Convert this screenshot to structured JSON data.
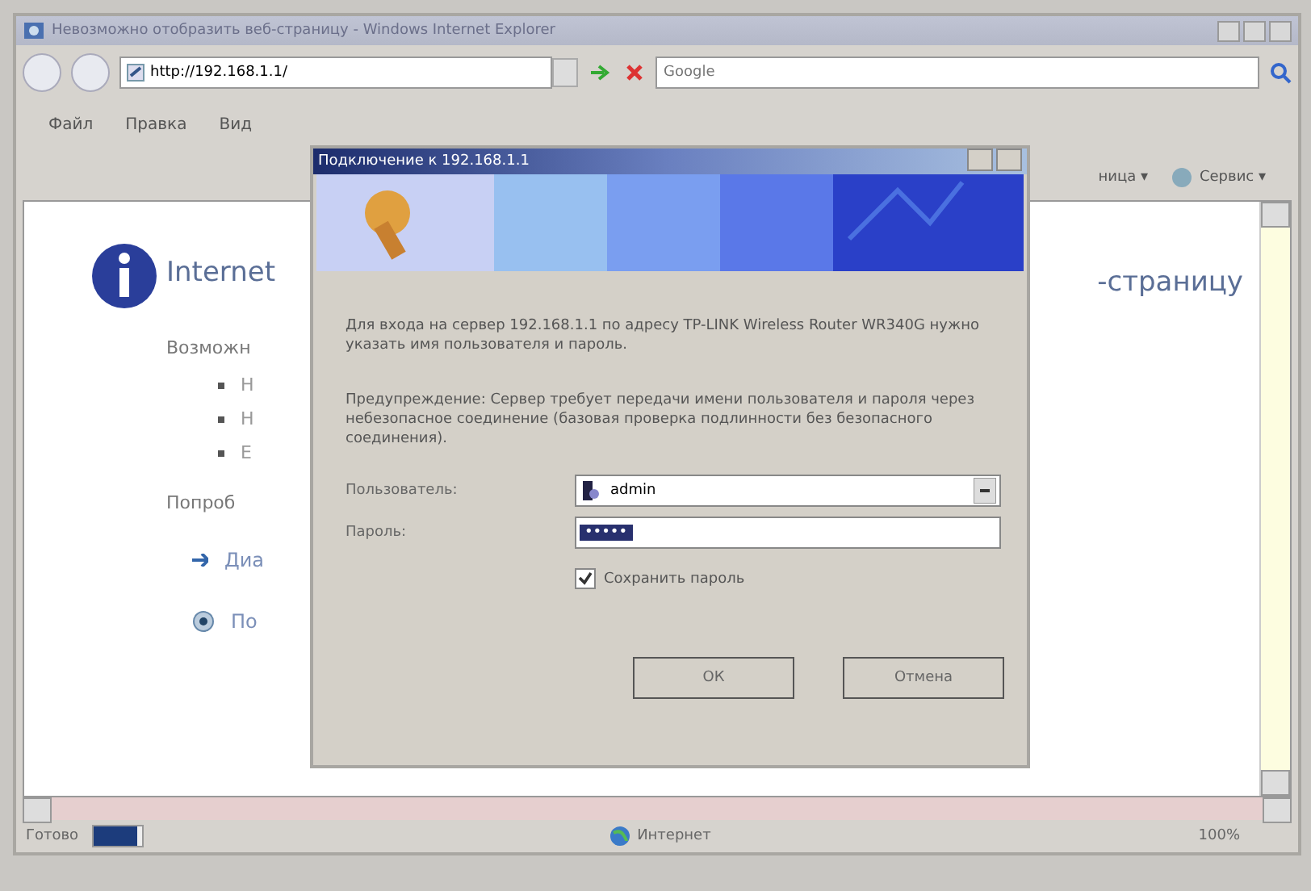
{
  "window": {
    "title": "Невозможно отобразить веб-страницу - Windows Internet Explorer"
  },
  "address_bar": {
    "value": "http://192.168.1.1/"
  },
  "search": {
    "placeholder": "Google"
  },
  "menu": [
    "Файл",
    "Правка",
    "Вид"
  ],
  "toolbar": [
    {
      "label": "ница ▾",
      "kind": "text"
    },
    {
      "label": "Сервис ▾",
      "kind": "tools"
    }
  ],
  "page": {
    "items": [
      {
        "kind": "heading",
        "text": "Internet"
      },
      {
        "kind": "text",
        "text": "Возможн"
      },
      {
        "kind": "bullet",
        "text": "Н"
      },
      {
        "kind": "bullet",
        "text": "Н"
      },
      {
        "kind": "bullet",
        "text": "Е"
      },
      {
        "kind": "text",
        "text": "Попроб"
      },
      {
        "kind": "arrow-link",
        "text": "Диа"
      },
      {
        "kind": "circle-link",
        "text": "По"
      }
    ],
    "heading_tail": "-страницу"
  },
  "dialog": {
    "title": "Подключение к 192.168.1.1",
    "message": "Для входа на сервер 192.168.1.1 по адресу TP-LINK Wireless Router WR340G нужно указать имя пользователя и пароль.",
    "warning": "Предупреждение: Сервер требует передачи имени пользователя и пароля через небезопасное соединение (базовая проверка подлинности без безопасного соединения).",
    "fields": [
      {
        "label": "Пользователь:",
        "value": "admin",
        "kind": "combo"
      },
      {
        "label": "Пароль:",
        "value": "•••••",
        "kind": "password"
      }
    ],
    "remember": {
      "label": "Сохранить пароль",
      "checked": true
    },
    "buttons": [
      "ОК",
      "Отмена"
    ]
  },
  "status_bar": {
    "text": "Готово",
    "progress": {
      "level": 0.9
    },
    "zone": "Интернет",
    "zoom": "100%"
  }
}
